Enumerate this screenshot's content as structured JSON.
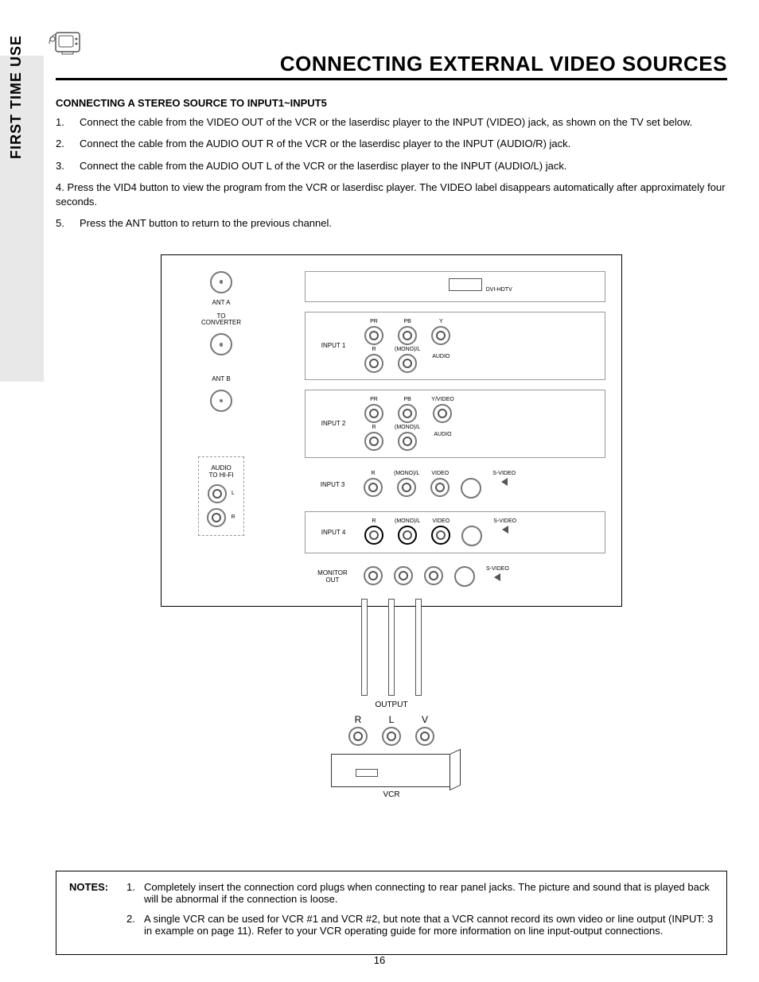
{
  "side_tab": "FIRST TIME USE",
  "title": "CONNECTING EXTERNAL VIDEO SOURCES",
  "section_heading": "CONNECTING A STEREO SOURCE TO INPUT1~INPUT5",
  "steps": [
    {
      "n": "1.",
      "t": "Connect the cable from the VIDEO OUT of the VCR or the laserdisc player to the INPUT (VIDEO) jack, as shown on the TV set below."
    },
    {
      "n": "2.",
      "t": "Connect the cable from the AUDIO OUT R of the VCR or the laserdisc player to the INPUT (AUDIO/R) jack."
    },
    {
      "n": "3.",
      "t": "Connect the cable from the AUDIO OUT L of the VCR or the laserdisc player to the INPUT (AUDIO/L) jack."
    }
  ],
  "step4": "4.    Press the VID4 button to view the program from the VCR or laserdisc player.  The VIDEO label disappears automatically after approximately four seconds.",
  "step5": {
    "n": "5.",
    "t": "Press the ANT button to return to the previous channel."
  },
  "diagram": {
    "ant_a": "ANT A",
    "to_conv": "TO\nCONVERTER",
    "ant_b": "ANT B",
    "audio_hifi": "AUDIO\nTO HI-FI",
    "L": "L",
    "R": "R",
    "dvi": "DVI-HDTV",
    "input1": "INPUT 1",
    "input2": "INPUT 2",
    "input3": "INPUT 3",
    "input4": "INPUT 4",
    "monitor": "MONITOR\nOUT",
    "pr": "PR",
    "pb": "PB",
    "y": "Y",
    "yvid": "Y/VIDEO",
    "r": "R",
    "monol": "(MONO)/L",
    "audio": "AUDIO",
    "video": "VIDEO",
    "svideo": "S-VIDEO",
    "output": "OUTPUT",
    "vR": "R",
    "vL": "L",
    "vV": "V",
    "vcr": "VCR"
  },
  "notes_label": "NOTES:",
  "notes": [
    {
      "n": "1.",
      "t": "Completely insert the connection cord plugs when connecting to rear panel jacks.  The picture and sound that is played back will be abnormal if the connection is loose."
    },
    {
      "n": "2.",
      "t": "A single VCR can be used for VCR #1 and VCR #2, but note that a VCR cannot record its own video or line output (INPUT: 3 in example on page 11).  Refer to your VCR operating guide for more information on line input-output connections."
    }
  ],
  "page_number": "16"
}
